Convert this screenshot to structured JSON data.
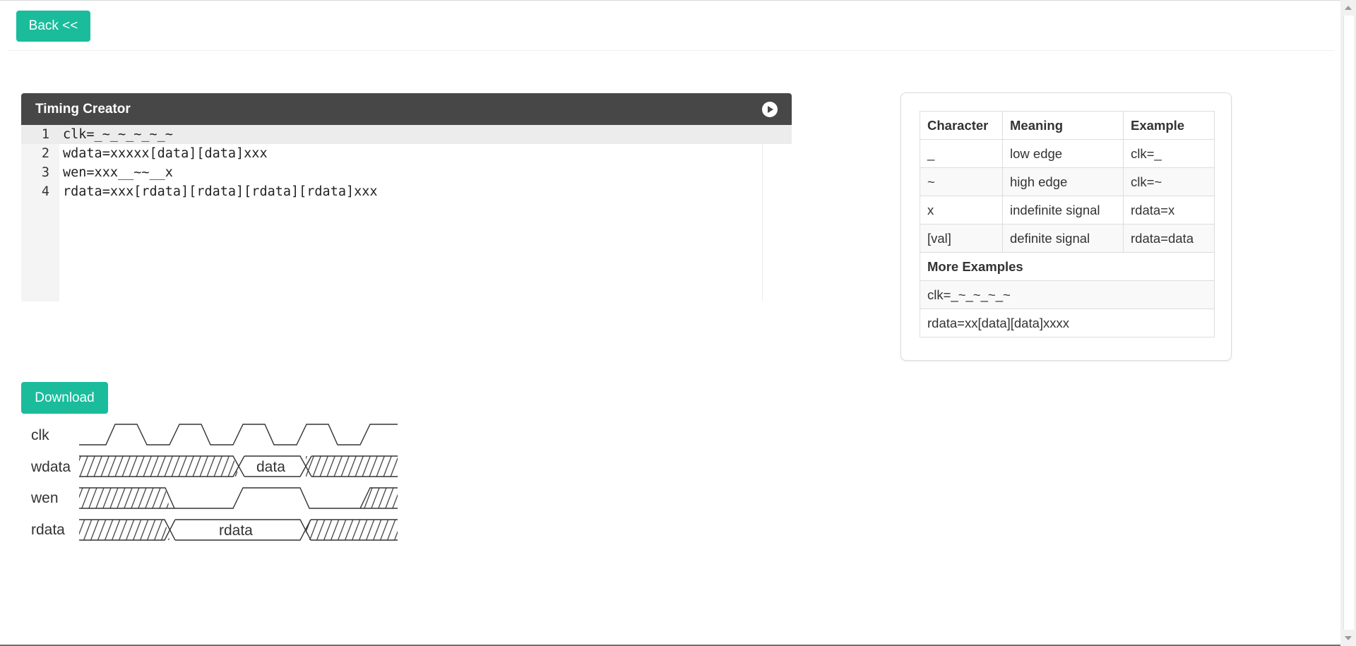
{
  "nav": {
    "back_label": "Back <<"
  },
  "editor": {
    "title": "Timing Creator",
    "run_icon": "play-circle-icon",
    "lines": [
      {
        "num": "1",
        "text": "clk=_~_~_~_~_~"
      },
      {
        "num": "2",
        "text": "wdata=xxxxx[data][data]xxx"
      },
      {
        "num": "3",
        "text": "wen=xxx__~~__x"
      },
      {
        "num": "4",
        "text": "rdata=xxx[rdata][rdata][rdata][rdata]xxx"
      }
    ]
  },
  "reference": {
    "headers": [
      "Character",
      "Meaning",
      "Example"
    ],
    "rows": [
      {
        "char": "_",
        "meaning": "low edge",
        "example": "clk=_"
      },
      {
        "char": "~",
        "meaning": "high edge",
        "example": "clk=~"
      },
      {
        "char": "x",
        "meaning": "indefinite signal",
        "example": "rdata=x"
      },
      {
        "char": "[val]",
        "meaning": "definite signal",
        "example": "rdata=data"
      }
    ],
    "more_title": "More Examples",
    "more": [
      "clk=_~_~_~_~",
      "rdata=xx[data][data]xxxx"
    ]
  },
  "download": {
    "label": "Download"
  },
  "waveform": {
    "signals": [
      {
        "name": "clk"
      },
      {
        "name": "wdata",
        "label": "data"
      },
      {
        "name": "wen"
      },
      {
        "name": "rdata",
        "label": "rdata"
      }
    ]
  },
  "colors": {
    "accent": "#1abc9c",
    "editor_header": "#474747"
  }
}
